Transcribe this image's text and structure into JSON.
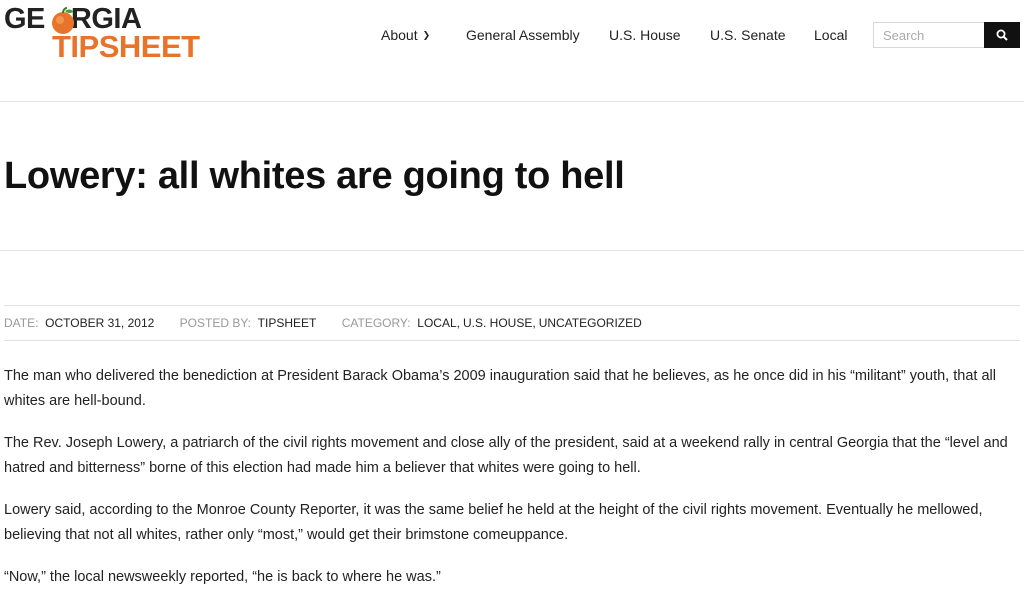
{
  "logo": {
    "line1": "GE",
    "line1b": "RGIA",
    "line2": "TIPSHEET"
  },
  "nav": {
    "items": [
      {
        "label": "About",
        "has_dropdown": true
      },
      {
        "label": "General Assembly"
      },
      {
        "label": "U.S. House"
      },
      {
        "label": "U.S. Senate"
      },
      {
        "label": "Local"
      }
    ]
  },
  "search": {
    "placeholder": "Search",
    "icon": "search-icon"
  },
  "article": {
    "title": "Lowery: all whites are going to hell",
    "meta": {
      "date_label": "DATE:",
      "date_value": "OCTOBER 31, 2012",
      "posted_label": "POSTED BY:",
      "posted_value": "TIPSHEET",
      "category_label": "CATEGORY:",
      "categories": [
        "LOCAL",
        "U.S. HOUSE",
        "UNCATEGORIZED"
      ]
    },
    "paragraphs": [
      "The man who delivered the benediction at President Barack Obama’s 2009 inauguration said that he believes, as he once did in his “militant” youth, that all whites are hell-bound.",
      "The Rev. Joseph Lowery, a patriarch of the civil rights movement and close ally of the president, said at a weekend rally in central Georgia that the “level and hatred and bitterness” borne of this election had made him a believer that whites were going to hell.",
      "Lowery said, according to the Monroe County Reporter, it was the same belief he held at the height of the civil rights movement. Eventually he mellowed, believing that not all whites, rather only “most,” would get their brimstone comeuppance.",
      "“Now,” the local newsweekly reported, “he is back to where he was.”"
    ]
  },
  "colors": {
    "logo_orange": "#e8742c",
    "search_button": "#111111",
    "meta_label": "#999999"
  }
}
